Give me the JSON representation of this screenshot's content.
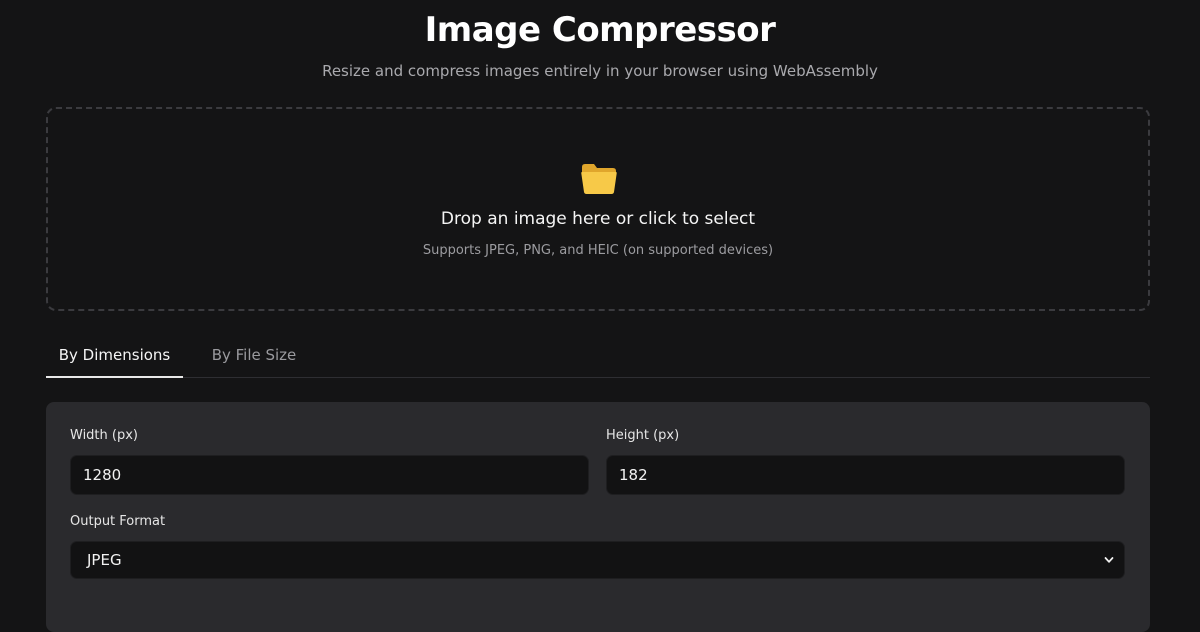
{
  "header": {
    "title": "Image Compressor",
    "subtitle": "Resize and compress images entirely in your browser using WebAssembly"
  },
  "dropzone": {
    "icon": "folder-icon",
    "text": "Drop an image here or click to select",
    "hint": "Supports JPEG, PNG, and HEIC (on supported devices)"
  },
  "tabs": [
    {
      "label": "By Dimensions",
      "active": true
    },
    {
      "label": "By File Size",
      "active": false
    }
  ],
  "form": {
    "width_label": "Width (px)",
    "width_value": "1280",
    "height_label": "Height (px)",
    "height_value": "182",
    "format_label": "Output Format",
    "format_value": "JPEG"
  },
  "colors": {
    "background": "#141415",
    "panel": "#2a2a2d",
    "input": "#121213",
    "folder": "#f4c542"
  }
}
